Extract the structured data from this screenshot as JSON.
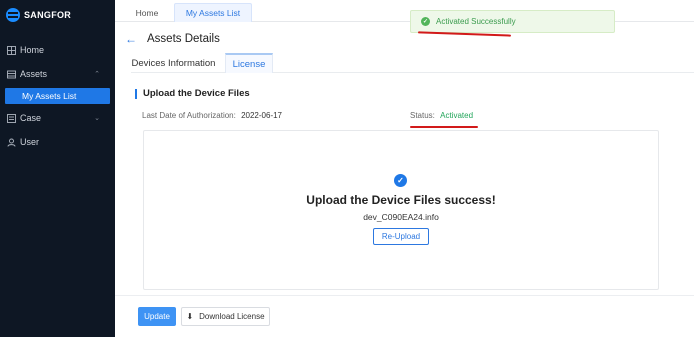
{
  "app": {
    "brand": "SANGFOR"
  },
  "sidebar": {
    "items": [
      {
        "label": "Home",
        "icon": "home-icon"
      },
      {
        "label": "Assets",
        "icon": "assets-icon",
        "expanded": true
      },
      {
        "label": "My Assets List",
        "selected": true
      },
      {
        "label": "Case",
        "icon": "case-icon",
        "expanded": false
      },
      {
        "label": "User",
        "icon": "user-icon"
      }
    ]
  },
  "top_tabs": [
    {
      "label": "Home"
    },
    {
      "label": "My Assets List",
      "active": true
    }
  ],
  "page": {
    "title": "Assets Details",
    "tabs": [
      {
        "label": "Devices Information"
      },
      {
        "label": "License",
        "active": true
      }
    ],
    "section_title": "Upload the Device Files",
    "last_auth_label": "Last Date of Authorization:",
    "last_auth_value": "2022-06-17",
    "status_label": "Status:",
    "status_value": "Activated"
  },
  "upload": {
    "success_text": "Upload the Device Files success!",
    "file_name": "dev_C090EA24.info",
    "reupload_label": "Re-Upload"
  },
  "footer": {
    "update_label": "Update",
    "download_label": "Download License"
  },
  "toast": {
    "message": "Activated Successfully"
  },
  "colors": {
    "accent": "#1f78e6",
    "sidebar_bg": "#0e1724",
    "success": "#22a55a",
    "annotation": "#d21a1a"
  }
}
